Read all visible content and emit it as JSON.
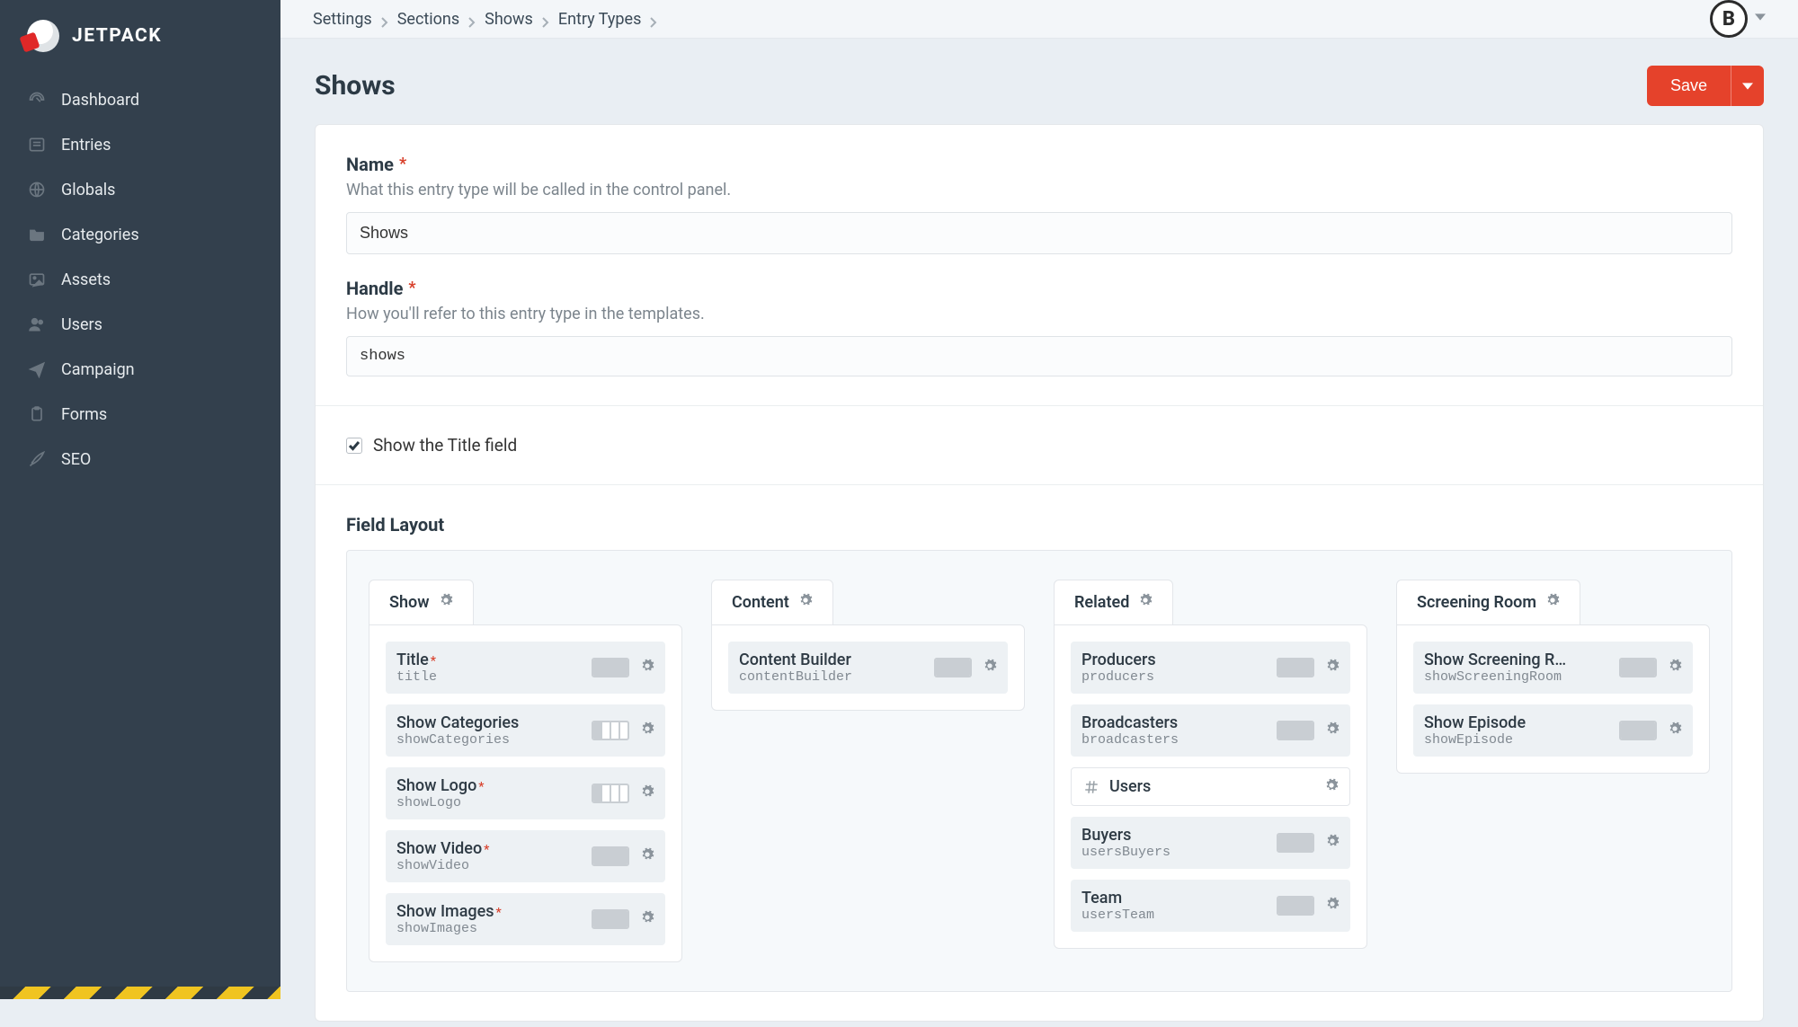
{
  "brand": {
    "name": "JETPACK"
  },
  "sidebar": {
    "items": [
      {
        "label": "Dashboard",
        "icon": "gauge-icon"
      },
      {
        "label": "Entries",
        "icon": "newspaper-icon"
      },
      {
        "label": "Globals",
        "icon": "globe-icon"
      },
      {
        "label": "Categories",
        "icon": "folder-icon"
      },
      {
        "label": "Assets",
        "icon": "image-icon"
      },
      {
        "label": "Users",
        "icon": "users-icon"
      },
      {
        "label": "Campaign",
        "icon": "paperplane-icon"
      },
      {
        "label": "Forms",
        "icon": "clipboard-icon"
      },
      {
        "label": "SEO",
        "icon": "rocket-icon"
      }
    ]
  },
  "breadcrumbs": [
    "Settings",
    "Sections",
    "Shows",
    "Entry Types"
  ],
  "user_initial": "B",
  "page_title": "Shows",
  "buttons": {
    "save": "Save"
  },
  "form": {
    "name": {
      "label": "Name",
      "hint": "What this entry type will be called in the control panel.",
      "value": "Shows",
      "required": true
    },
    "handle": {
      "label": "Handle",
      "hint": "How you'll refer to this entry type in the templates.",
      "value": "shows",
      "required": true
    },
    "show_title": {
      "label": "Show the Title field",
      "checked": true
    }
  },
  "field_layout": {
    "label": "Field Layout",
    "tabs": [
      {
        "name": "Show",
        "fields": [
          {
            "title": "Title",
            "handle": "title",
            "required": true,
            "width": 4
          },
          {
            "title": "Show Categories",
            "handle": "showCategories",
            "required": false,
            "width": 1
          },
          {
            "title": "Show Logo",
            "handle": "showLogo",
            "required": true,
            "width": 1
          },
          {
            "title": "Show Video",
            "handle": "showVideo",
            "required": true,
            "width": 4
          },
          {
            "title": "Show Images",
            "handle": "showImages",
            "required": true,
            "width": 4
          }
        ]
      },
      {
        "name": "Content",
        "fields": [
          {
            "title": "Content Builder",
            "handle": "contentBuilder",
            "required": false,
            "width": 4
          }
        ]
      },
      {
        "name": "Related",
        "fields": [
          {
            "title": "Producers",
            "handle": "producers",
            "required": false,
            "width": 4
          },
          {
            "title": "Broadcasters",
            "handle": "broadcasters",
            "required": false,
            "width": 4
          },
          {
            "title": "Users",
            "handle": "",
            "blank": true
          },
          {
            "title": "Buyers",
            "handle": "usersBuyers",
            "required": false,
            "width": 4
          },
          {
            "title": "Team",
            "handle": "usersTeam",
            "required": false,
            "width": 4
          }
        ]
      },
      {
        "name": "Screening Room",
        "fields": [
          {
            "title": "Show Screening R…",
            "handle": "showScreeningRoom",
            "required": false,
            "width": 4
          },
          {
            "title": "Show Episode",
            "handle": "showEpisode",
            "required": false,
            "width": 4
          }
        ]
      }
    ]
  }
}
